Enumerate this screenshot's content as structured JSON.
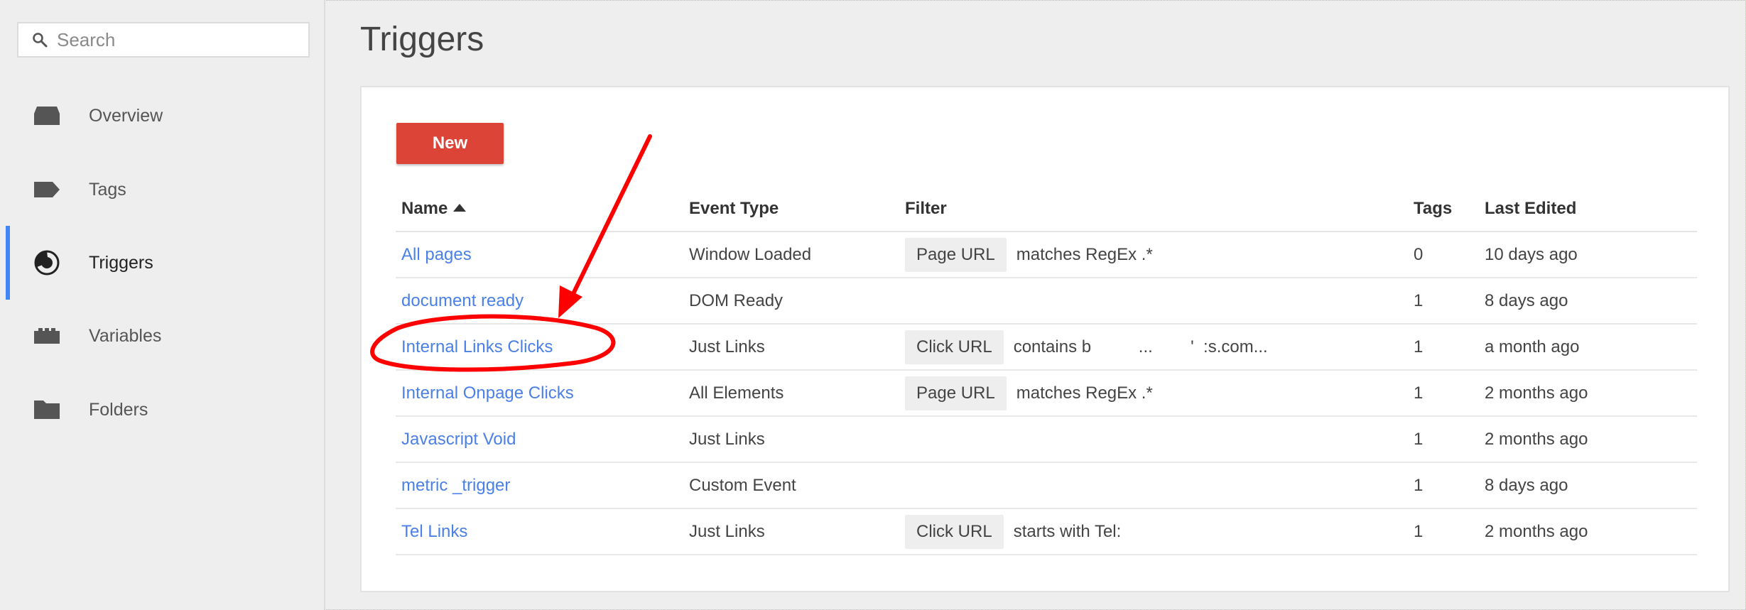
{
  "sidebar": {
    "search_placeholder": "Search",
    "items": [
      {
        "label": "Overview",
        "icon": "inbox-icon"
      },
      {
        "label": "Tags",
        "icon": "tag-icon"
      },
      {
        "label": "Triggers",
        "icon": "trigger-icon",
        "active": true
      },
      {
        "label": "Variables",
        "icon": "variables-icon"
      },
      {
        "label": "Folders",
        "icon": "folder-icon"
      }
    ]
  },
  "main": {
    "title": "Triggers",
    "new_button": "New",
    "columns": [
      "Name",
      "Event Type",
      "Filter",
      "Tags",
      "Last Edited"
    ],
    "rows": [
      {
        "name": "All pages",
        "event_type": "Window Loaded",
        "filter_chip": "Page URL",
        "filter_text": "matches RegEx .*",
        "tags": "0",
        "last_edited": "10 days ago"
      },
      {
        "name": "document ready",
        "event_type": "DOM Ready",
        "filter_chip": "",
        "filter_text": "",
        "tags": "1",
        "last_edited": "8 days ago"
      },
      {
        "name": "Internal Links Clicks",
        "event_type": "Just Links",
        "filter_chip": "Click URL",
        "filter_text": "contains b          ...        '  :s.com...",
        "tags": "1",
        "last_edited": "a month ago"
      },
      {
        "name": "Internal Onpage Clicks",
        "event_type": "All Elements",
        "filter_chip": "Page URL",
        "filter_text": "matches RegEx .*",
        "tags": "1",
        "last_edited": "2 months ago"
      },
      {
        "name": "Javascript Void",
        "event_type": "Just Links",
        "filter_chip": "",
        "filter_text": "",
        "tags": "1",
        "last_edited": "2 months ago"
      },
      {
        "name": "metric _trigger",
        "event_type": "Custom Event",
        "filter_chip": "",
        "filter_text": "",
        "tags": "1",
        "last_edited": "8 days ago"
      },
      {
        "name": "Tel Links",
        "event_type": "Just Links",
        "filter_chip": "Click URL",
        "filter_text": "starts with Tel:",
        "tags": "1",
        "last_edited": "2 months ago"
      }
    ]
  },
  "colors": {
    "accent_blue": "#4285f4",
    "new_button_red": "#db4437",
    "link_blue": "#4a80e8",
    "annotation_red": "#ff0000"
  }
}
